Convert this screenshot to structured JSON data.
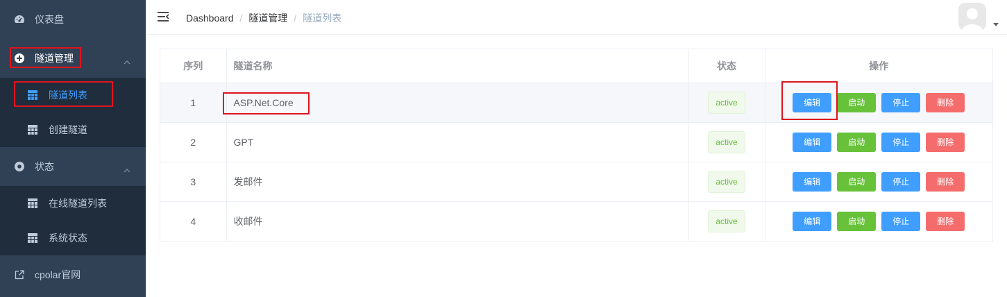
{
  "sidebar": {
    "dashboard": {
      "label": "仪表盘"
    },
    "tunnel_mgmt": {
      "label": "隧道管理",
      "items": [
        {
          "label": "隧道列表"
        },
        {
          "label": "创建隧道"
        }
      ]
    },
    "status": {
      "label": "状态",
      "items": [
        {
          "label": "在线隧道列表"
        },
        {
          "label": "系统状态"
        }
      ]
    },
    "official": {
      "label": "cpolar官网"
    }
  },
  "header": {
    "breadcrumb": [
      "Dashboard",
      "隧道管理",
      "隧道列表"
    ],
    "separator": "/"
  },
  "table": {
    "columns": {
      "index": "序列",
      "name": "隧道名称",
      "status": "状态",
      "ops": "操作"
    },
    "rows": [
      {
        "index": "1",
        "name": "ASP.Net.Core",
        "status": "active"
      },
      {
        "index": "2",
        "name": "GPT",
        "status": "active"
      },
      {
        "index": "3",
        "name": "发邮件",
        "status": "active"
      },
      {
        "index": "4",
        "name": "收邮件",
        "status": "active"
      }
    ],
    "actions": {
      "edit": "编辑",
      "start": "启动",
      "stop": "停止",
      "delete": "删除"
    }
  },
  "colors": {
    "sidebar_bg": "#304156",
    "submenu_bg": "#1f2d3d",
    "accent": "#409eff",
    "success": "#67c23a",
    "danger": "#f56c6c",
    "highlight_box": "#e0141e"
  }
}
